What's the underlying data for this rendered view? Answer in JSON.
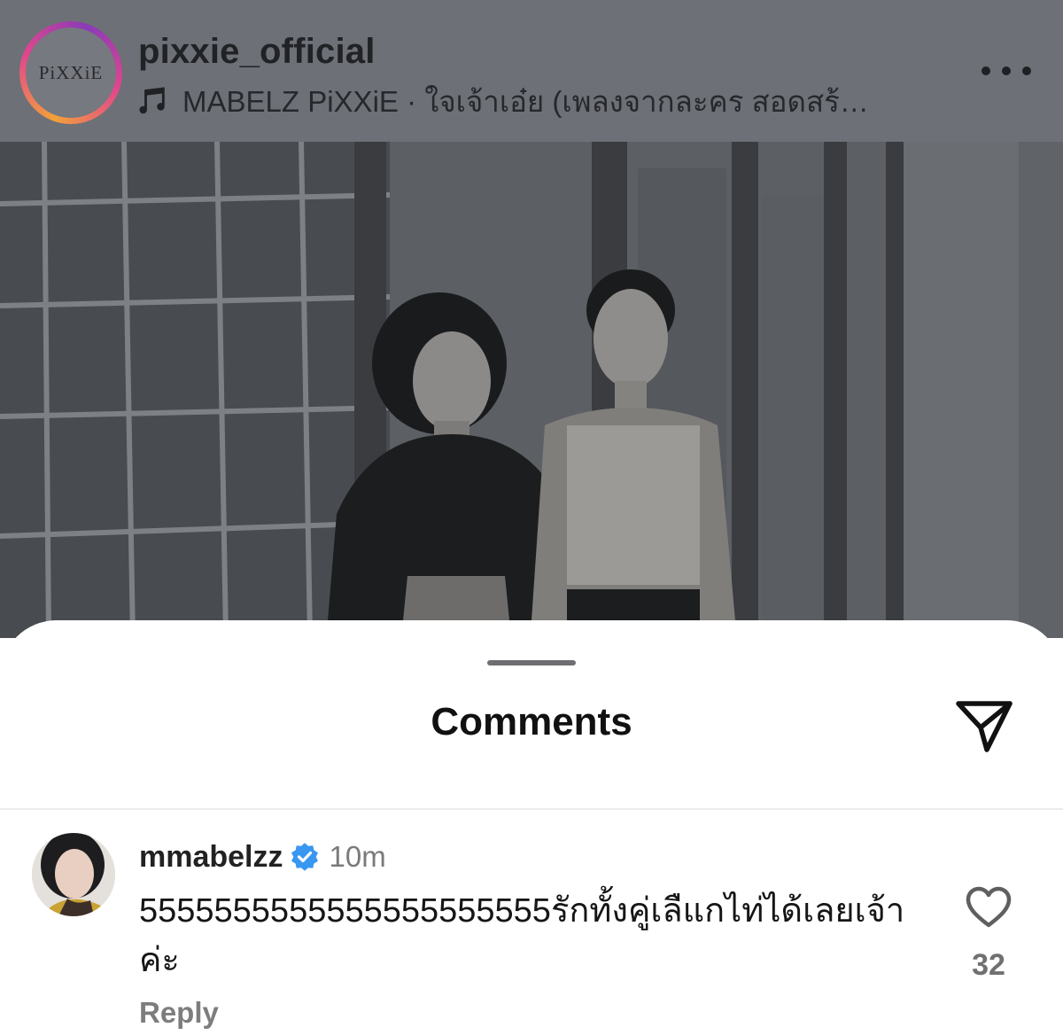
{
  "post": {
    "account": "pixxie_official",
    "avatar_logo": "PiXXiE",
    "music": "MABELZ PiXXiE · ใจเจ้าเอ๋ย (เพลงจากละคร สอดสร้…",
    "icons": {
      "music": "music-note-icon",
      "more": "more-options-icon"
    }
  },
  "sheet": {
    "title": "Comments",
    "share_icon": "paper-plane-icon"
  },
  "comments": [
    {
      "username": "mmabelzz",
      "verified": true,
      "time": "10m",
      "text": "5555555555555555555555รักทั้งคู่เลืแกไท่ได้เลยเจ้าค่ะ",
      "reply_label": "Reply",
      "likes": "32"
    }
  ],
  "colors": {
    "dim_overlay": "#6d7076",
    "verified_blue": "#3897f0",
    "ring_gradient": [
      "#f2a13a",
      "#e2478c",
      "#8a3ab9"
    ]
  }
}
